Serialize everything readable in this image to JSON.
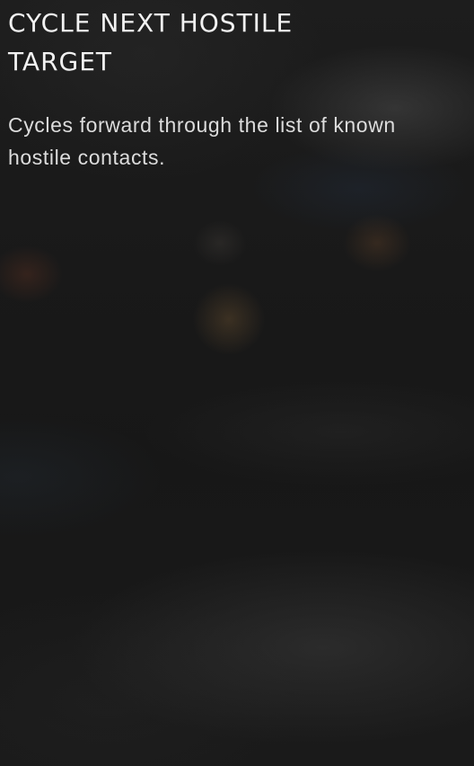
{
  "panel": {
    "title": "CYCLE NEXT HOSTILE TARGET",
    "description": "Cycles forward through the list of known hostile contacts."
  }
}
